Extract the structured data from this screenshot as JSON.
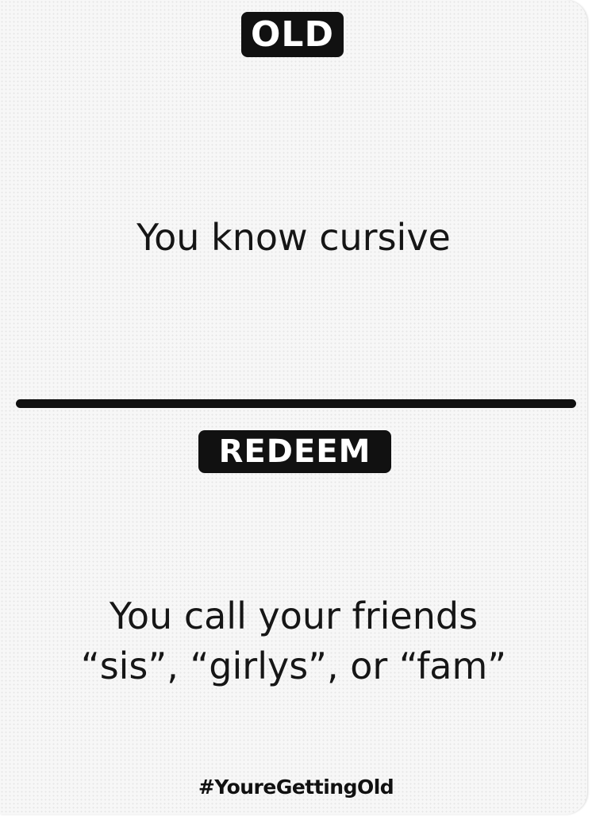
{
  "card": {
    "old_badge": "OLD",
    "old_text": "You know cursive",
    "redeem_badge": "REDEEM",
    "redeem_line_1": "You call your friends",
    "redeem_line_2": "“sis”, “girlys”, or “fam”",
    "hashtag": "#YoureGettingOld"
  },
  "colors": {
    "card_background": "#f7f7f7",
    "ink": "#111111"
  }
}
